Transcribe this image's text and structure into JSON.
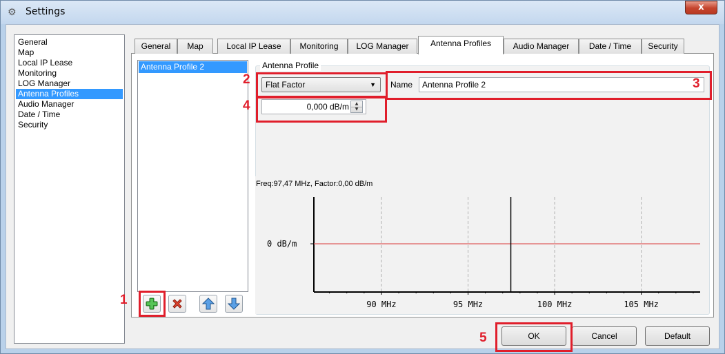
{
  "window": {
    "title": "Settings",
    "close_label": "x"
  },
  "nav": {
    "items": [
      "General",
      "Map",
      "Local IP Lease",
      "Monitoring",
      "LOG Manager",
      "Antenna Profiles",
      "Audio Manager",
      "Date / Time",
      "Security"
    ],
    "selected": "Antenna Profiles"
  },
  "tabs": [
    "General",
    "Map",
    "Local IP Lease",
    "Monitoring",
    "LOG Manager",
    "Antenna Profiles",
    "Audio Manager",
    "Date / Time",
    "Security"
  ],
  "active_tab": "Antenna Profiles",
  "profiles": {
    "items": [
      "Antenna Profile 2"
    ],
    "selected": "Antenna Profile 2"
  },
  "toolbar": {
    "add_icon": "plus-icon",
    "remove_icon": "x-icon",
    "up_icon": "arrow-up-icon",
    "down_icon": "arrow-down-icon"
  },
  "antenna_profile": {
    "group_title": "Antenna Profile",
    "type_value": "Flat Factor",
    "name_label": "Name",
    "name_value": "Antenna Profile 2",
    "factor_value": "0,000 dB/m"
  },
  "chart_data": {
    "type": "line",
    "readout": "Freq:97,47 MHz, Factor:0,00 dB/m",
    "x_tick_labels": [
      "90 MHz",
      "95 MHz",
      "100 MHz",
      "105 MHz"
    ],
    "x_ticks": [
      90,
      95,
      100,
      105
    ],
    "xlim": [
      86.1,
      108.4
    ],
    "y_tick_labels": [
      "0 dB/m"
    ],
    "series": [
      {
        "x": [
          86.1,
          108.4
        ],
        "y": [
          0,
          0
        ],
        "color": "#e06060"
      }
    ],
    "cursor_x": 97.47
  },
  "buttons": {
    "ok": "OK",
    "cancel": "Cancel",
    "default": "Default"
  },
  "annotations": [
    "1",
    "2",
    "3",
    "4",
    "5"
  ],
  "colors": {
    "selection": "#3399ff",
    "annotation": "#e01e2b",
    "series": "#e06060"
  }
}
